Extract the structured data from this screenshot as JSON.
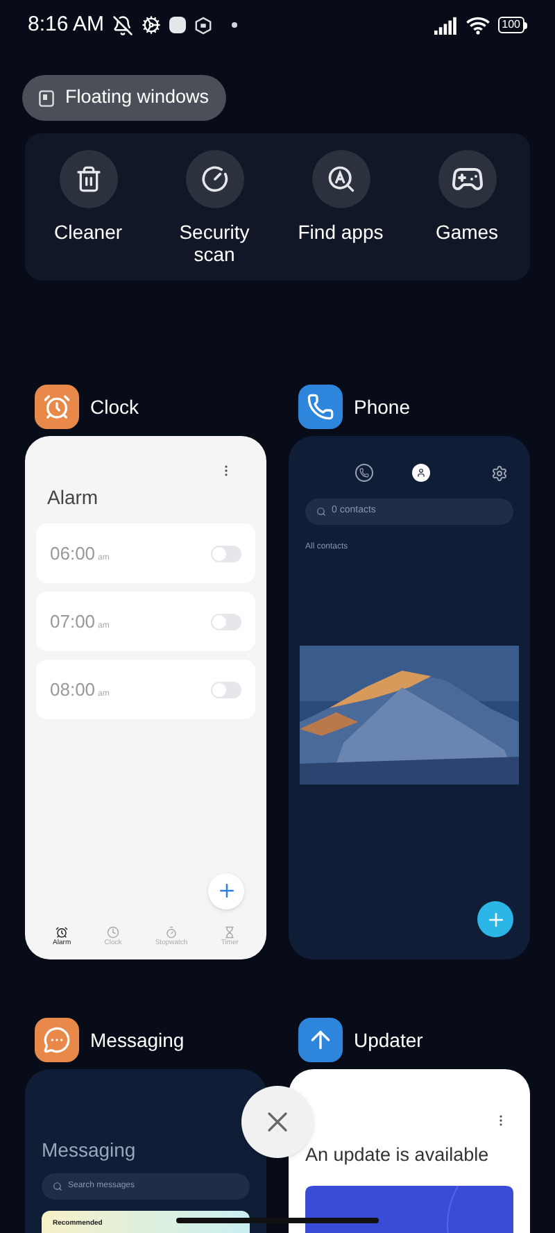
{
  "status_bar": {
    "time": "8:16 AM",
    "battery": "100"
  },
  "floating_windows": {
    "label": "Floating windows"
  },
  "tools": [
    {
      "label": "Cleaner"
    },
    {
      "label": "Security scan"
    },
    {
      "label": "Find apps"
    },
    {
      "label": "Games"
    }
  ],
  "apps": [
    {
      "kind": "clock",
      "name": "Clock",
      "title": "Alarm",
      "alarms": [
        {
          "time": "06:00",
          "suffix": "am",
          "on": false
        },
        {
          "time": "07:00",
          "suffix": "am",
          "on": false
        },
        {
          "time": "08:00",
          "suffix": "am",
          "on": false
        }
      ],
      "tabs": [
        {
          "label": "Alarm",
          "selected": true
        },
        {
          "label": "Clock",
          "selected": false
        },
        {
          "label": "Stopwatch",
          "selected": false
        },
        {
          "label": "Timer",
          "selected": false
        }
      ]
    },
    {
      "kind": "phone",
      "name": "Phone",
      "tabs": [
        {
          "selected": false
        },
        {
          "selected": true
        }
      ],
      "search": {
        "placeholder": "0 contacts"
      },
      "filter": "All contacts"
    },
    {
      "kind": "messaging",
      "name": "Messaging",
      "title": "Messaging",
      "search": {
        "placeholder": "Search messages"
      },
      "banner": "Recommended"
    },
    {
      "kind": "updater",
      "name": "Updater",
      "title": "An update is available"
    }
  ]
}
